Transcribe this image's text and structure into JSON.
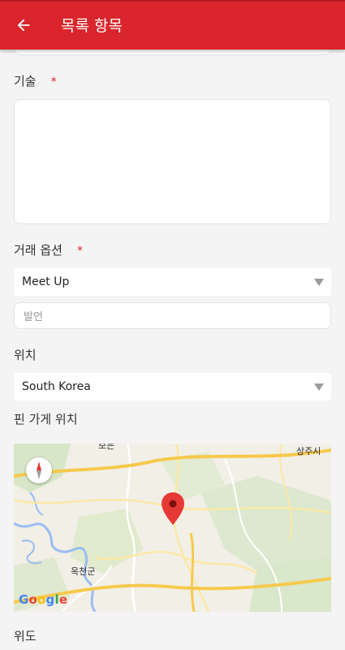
{
  "header": {
    "title": "목록 항목",
    "back_icon": "arrow-left-icon"
  },
  "form": {
    "description_label": "기술",
    "required_mark": "*",
    "deal_option_label": "거래 옵션",
    "deal_option_value": "Meet Up",
    "meetup_placeholder": "발언",
    "location_label": "위치",
    "location_value": "South Korea",
    "pin_label": "핀 가게 위치",
    "latitude_label": "위도"
  },
  "map": {
    "place_1": "상주시",
    "place_2": "옥천군",
    "place_3": "보은",
    "logo": "Google",
    "marker_icon": "map-pin-icon",
    "compass_icon": "compass-icon"
  },
  "colors": {
    "accent": "#d9252b",
    "background": "#f4f4f4"
  }
}
